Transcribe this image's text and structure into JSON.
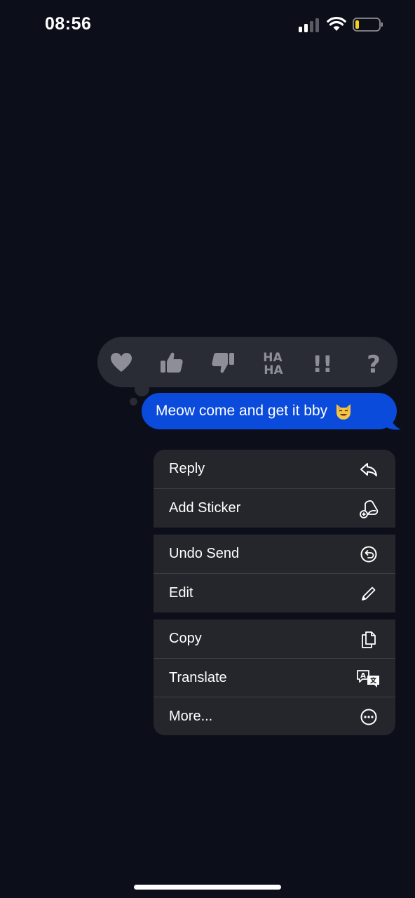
{
  "status_bar": {
    "time": "08:56"
  },
  "tapbacks": [
    {
      "name": "heart-icon"
    },
    {
      "name": "thumbs-up-icon"
    },
    {
      "name": "thumbs-down-icon"
    },
    {
      "name": "haha-icon",
      "text_line1": "HA",
      "text_line2": "HA"
    },
    {
      "name": "emphasize-icon",
      "text": "!!"
    },
    {
      "name": "question-icon",
      "text": "?"
    }
  ],
  "message": {
    "text": "Meow come and get it bby",
    "emoji": "smiling-cat-icon"
  },
  "menu": {
    "reply": "Reply",
    "add_sticker": "Add Sticker",
    "undo_send": "Undo Send",
    "edit": "Edit",
    "copy": "Copy",
    "translate": "Translate",
    "more": "More..."
  },
  "colors": {
    "background": "#0c0e1a",
    "bubble": "#0a4bdb",
    "menu_item": "#25262c",
    "tapback_bar": "#2a2c35",
    "tapback_icon": "#8e8f96",
    "battery_low": "#f2d21b"
  }
}
